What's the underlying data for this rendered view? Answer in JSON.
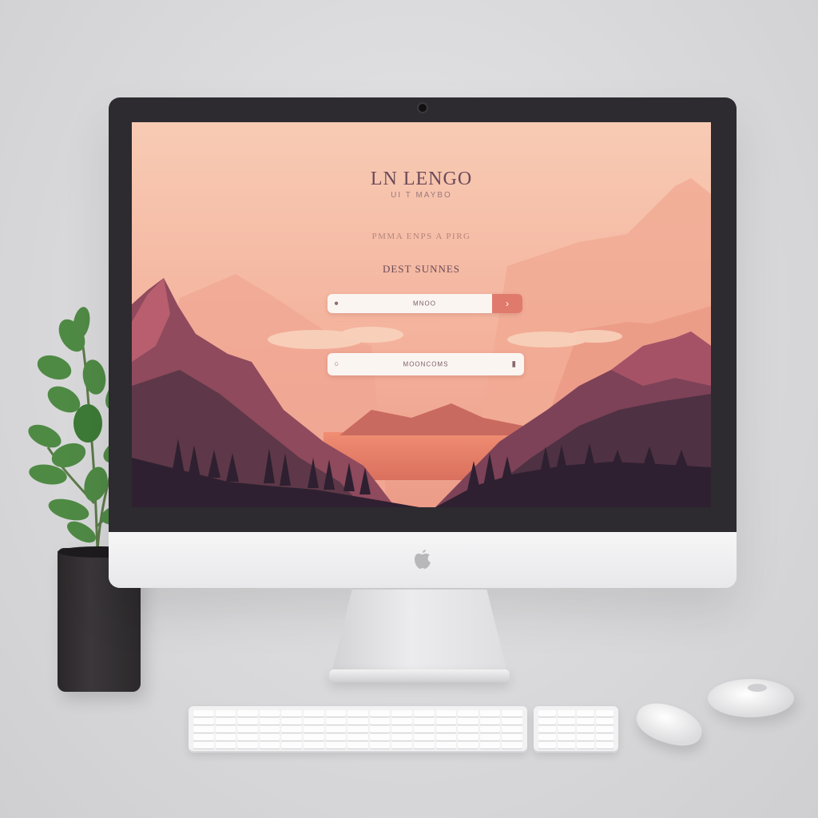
{
  "screen": {
    "app_title": "LN LENGO",
    "app_subtitle": "UI T MAYBO",
    "tagline": "PMMA ENPS A PIRG",
    "section_label": "DEST SUNNES",
    "field_top": {
      "placeholder": "MNOO",
      "left_icon": "search-icon",
      "button_icon": "arrow-right-icon"
    },
    "fine_print": "· · · · · · · · · · · · · · · · · · · · · · · · · · · · ·",
    "field_bottom": {
      "placeholder": "MOONCOMS",
      "left_icon": "user-icon",
      "right_icon": "lock-icon"
    }
  },
  "colors": {
    "sky_top": "#f6c4ad",
    "sky_bottom": "#f0a38e",
    "mountain_dark": "#3a2a3a",
    "mountain_mid": "#7a4358",
    "accent_button": "#e07a6c",
    "bezel": "#2d2b30",
    "pot": "#2c292b",
    "leaf": "#4f8a45"
  },
  "devices": {
    "monitor_logo": "apple-logo-icon",
    "keyboard": "keyboard",
    "numpad": "numeric-keypad",
    "mouse": "mouse",
    "plant": "potted-plant"
  }
}
